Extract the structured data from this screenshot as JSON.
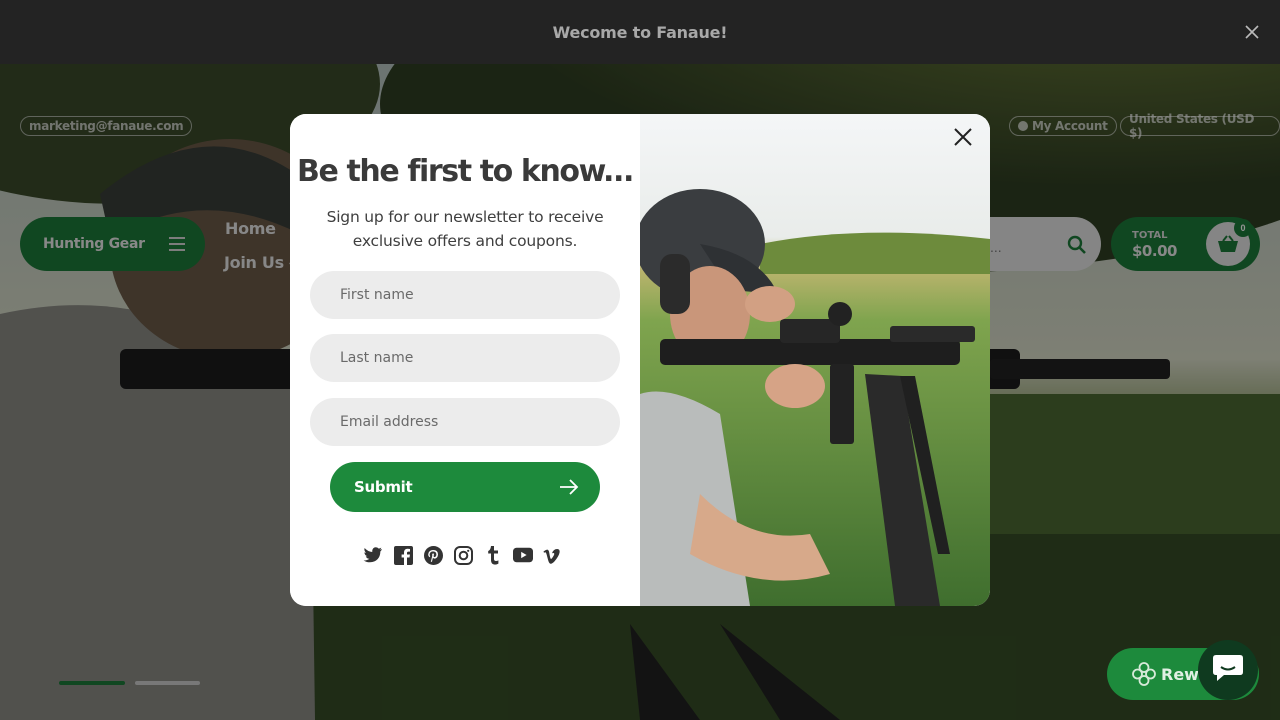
{
  "announcement": {
    "text": "Wecome to Fanaue!"
  },
  "header": {
    "email": "marketing@fanaue.com",
    "account": "My Account",
    "currency": "United States (USD $)",
    "menu_label": "Hunting Gear",
    "nav": [
      {
        "label": "Home"
      },
      {
        "label": "Join Us"
      }
    ],
    "search_placeholder_fragment": "...",
    "cart": {
      "total_label": "TOTAL",
      "total_value": "$0.00",
      "count": "0"
    }
  },
  "popup": {
    "title": "Be the first to know...",
    "subtitle": "Sign up for our newsletter to receive exclusive offers and coupons.",
    "fields": {
      "first_name": "First name",
      "last_name": "Last name",
      "email": "Email address"
    },
    "submit_label": "Submit",
    "socials": [
      "twitter-icon",
      "facebook-icon",
      "pinterest-icon",
      "instagram-icon",
      "tumblr-icon",
      "youtube-icon",
      "vimeo-icon"
    ]
  },
  "rewards": {
    "label": "Rewards"
  },
  "colors": {
    "brand_green": "#1d8a3c",
    "announcement_bg": "#232323"
  }
}
